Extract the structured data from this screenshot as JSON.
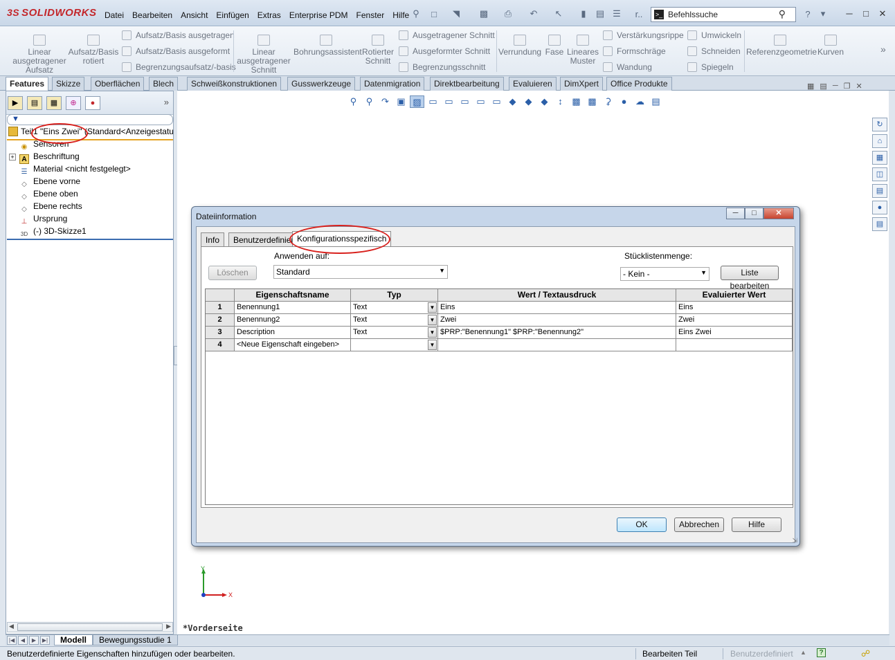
{
  "app": {
    "logo": "SOLIDWORKS",
    "menu": [
      "Datei",
      "Bearbeiten",
      "Ansicht",
      "Einfügen",
      "Extras",
      "Enterprise PDM",
      "Fenster",
      "Hilfe"
    ],
    "search_placeholder": "Befehlssuche"
  },
  "ribbon": {
    "big": [
      {
        "label": "Linear\nausgetragener\nAufsatz",
        "icon": "extrude-boss-icon"
      },
      {
        "label": "Aufsatz/Basis\nrotiert",
        "icon": "revolve-boss-icon"
      },
      {
        "label": "Linear\nausgetragener\nSchnitt",
        "icon": "extrude-cut-icon"
      },
      {
        "label": "Bohrungsassistent",
        "icon": "hole-wizard-icon"
      },
      {
        "label": "Rotierter\nSchnitt",
        "icon": "revolve-cut-icon"
      },
      {
        "label": "Verrundung",
        "icon": "fillet-icon"
      },
      {
        "label": "Fase",
        "icon": "chamfer-icon"
      },
      {
        "label": "Lineares\nMuster",
        "icon": "linear-pattern-icon"
      },
      {
        "label": "Referenzgeometrie",
        "icon": "reference-geometry-icon"
      },
      {
        "label": "Kurven",
        "icon": "curves-icon"
      }
    ],
    "small": [
      "Aufsatz/Basis ausgetragen",
      "Aufsatz/Basis ausgeformt",
      "Begrenzungsaufsatz/-basis",
      "Ausgetragener Schnitt",
      "Ausgeformter Schnitt",
      "Begrenzungsschnitt",
      "Verstärkungsrippe",
      "Formschräge",
      "Wandung",
      "Umwickeln",
      "Schneiden",
      "Spiegeln"
    ]
  },
  "command_tabs": [
    "Features",
    "Skizze",
    "Oberflächen",
    "Blech",
    "Schweißkonstruktionen",
    "Gusswerkzeuge",
    "Datenmigration",
    "Direktbearbeitung",
    "Evaluieren",
    "DimXpert",
    "Office Produkte"
  ],
  "active_command_tab": "Features",
  "tree": {
    "root": "Teil1 \"Eins Zwei\" (Standard<Anzeigestatu",
    "items": [
      {
        "label": "Sensoren",
        "icon": "sensor-icon"
      },
      {
        "label": "Beschriftung",
        "icon": "annotation-icon"
      },
      {
        "label": "Material <nicht festgelegt>",
        "icon": "material-icon"
      },
      {
        "label": "Ebene vorne",
        "icon": "plane-icon"
      },
      {
        "label": "Ebene oben",
        "icon": "plane-icon"
      },
      {
        "label": "Ebene rechts",
        "icon": "plane-icon"
      },
      {
        "label": "Ursprung",
        "icon": "origin-icon"
      },
      {
        "label": "(-) 3D-Skizze1",
        "icon": "3d-sketch-icon"
      }
    ]
  },
  "graphics": {
    "view_label": "*Vorderseite",
    "triad_x": "X",
    "triad_y": "Y"
  },
  "bottom_tabs": [
    "Modell",
    "Bewegungsstudie 1"
  ],
  "status": {
    "message": "Benutzerdefinierte Eigenschaften hinzufügen oder bearbeiten.",
    "mode": "Bearbeiten Teil",
    "units": "Benutzerdefiniert"
  },
  "dialog": {
    "title": "Dateiinformation",
    "tabs": [
      "Info",
      "Benutzerdefiniert",
      "Konfigurationsspezifisch"
    ],
    "active_tab": "Konfigurationsspezifisch",
    "delete_button": "Löschen",
    "apply_to_label": "Anwenden auf:",
    "apply_to_value": "Standard",
    "bom_qty_label": "Stücklistenmenge:",
    "bom_qty_value": "- Kein -",
    "edit_list_button": "Liste bearbeiten",
    "columns": [
      "Eigenschaftsname",
      "Typ",
      "Wert / Textausdruck",
      "Evaluierter Wert"
    ],
    "rows": [
      {
        "num": "1",
        "name": "Benennung1",
        "type": "Text",
        "value": "Eins",
        "evaluated": "Eins"
      },
      {
        "num": "2",
        "name": "Benennung2",
        "type": "Text",
        "value": "Zwei",
        "evaluated": "Zwei"
      },
      {
        "num": "3",
        "name": "Description",
        "type": "Text",
        "value": "$PRP:\"Benennung1\" $PRP:\"Benennung2\"",
        "evaluated": "Eins Zwei"
      },
      {
        "num": "4",
        "name": "<Neue Eigenschaft eingeben>",
        "type": "",
        "value": "",
        "evaluated": ""
      }
    ],
    "ok_button": "OK",
    "cancel_button": "Abbrechen",
    "help_button": "Hilfe"
  },
  "colors": {
    "annotation_circle": "#d8201c",
    "brand": "#c3272b"
  }
}
